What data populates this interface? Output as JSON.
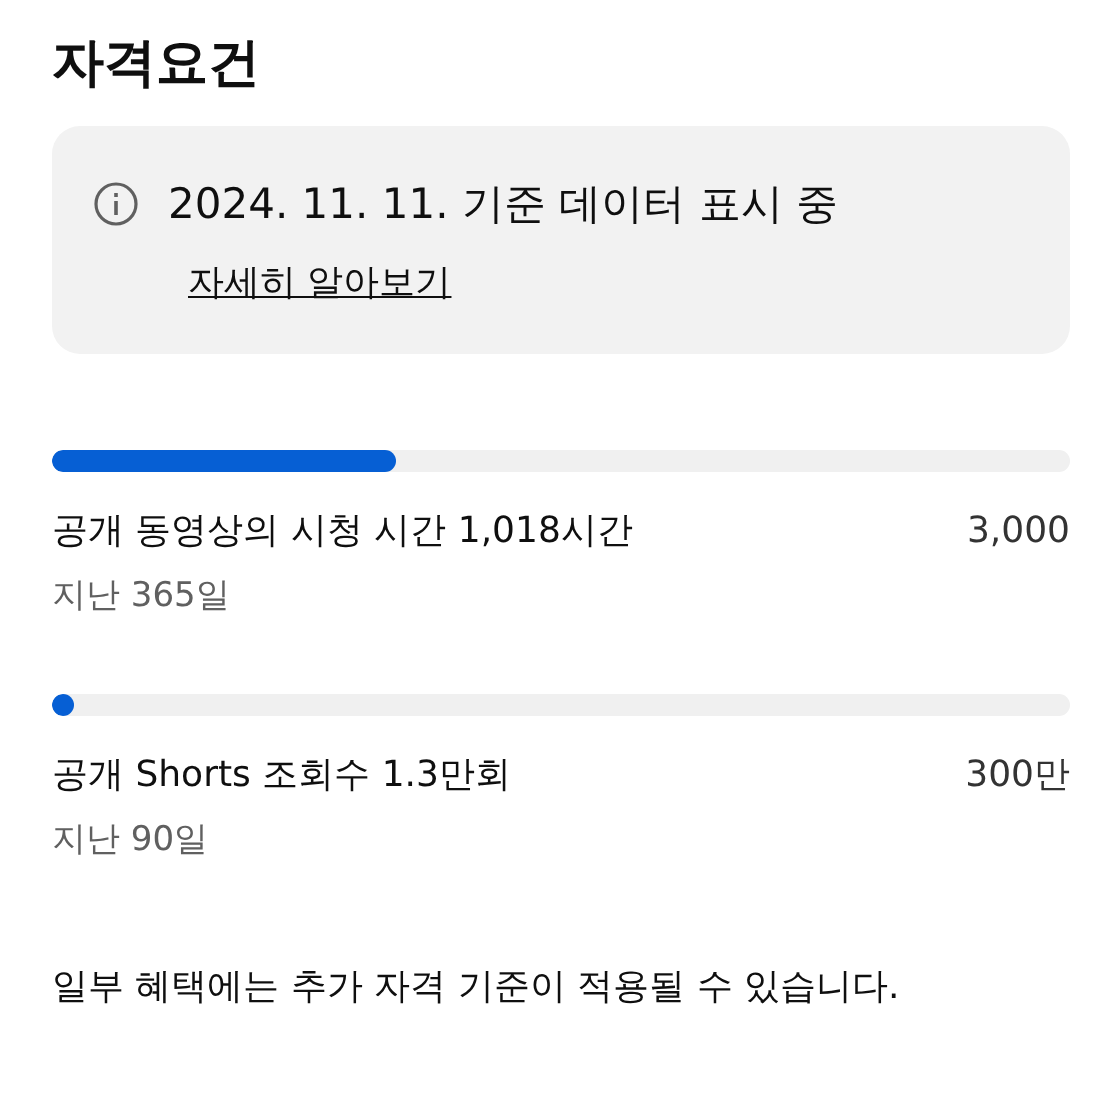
{
  "title": "자격요건",
  "notice": {
    "text": "2024. 11. 11. 기준 데이터 표시 중",
    "link": "자세히 알아보기"
  },
  "metrics": [
    {
      "label": "공개 동영상의 시청 시간 1,018시간",
      "target": "3,000",
      "period": "지난 365일",
      "level": 0.338
    },
    {
      "label": "공개 Shorts 조회수 1.3만회",
      "target": "300만",
      "period": "지난 90일",
      "level": 0.004
    }
  ],
  "footer": "일부 혜택에는 추가 자격 기준이 적용될 수 있습니다."
}
